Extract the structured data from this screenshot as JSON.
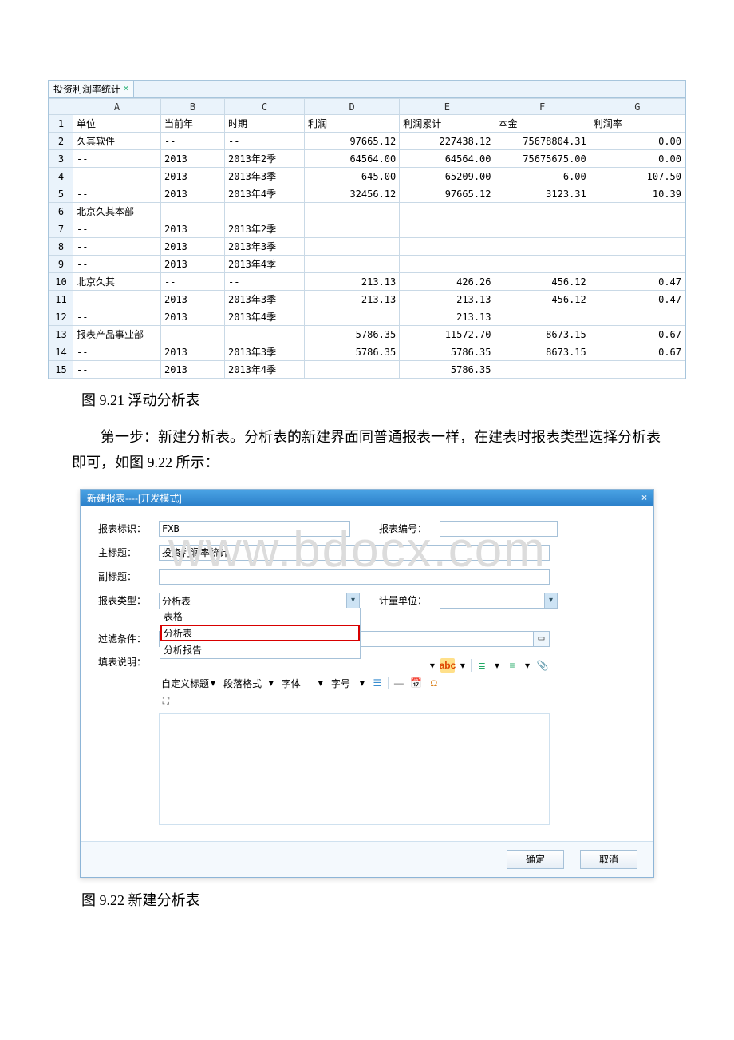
{
  "sheet": {
    "tab_label": "投资利润率统计",
    "columns": [
      "",
      "A",
      "B",
      "C",
      "D",
      "E",
      "F",
      "G"
    ],
    "header_row": [
      "单位",
      "当前年",
      "时期",
      "利润",
      "利润累计",
      "本金",
      "利润率"
    ],
    "rows": [
      {
        "n": "1",
        "A": "单位",
        "B": "当前年",
        "C": "时期",
        "D": "利润",
        "E": "利润累计",
        "F": "本金",
        "G": "利润率",
        "txtRow": true
      },
      {
        "n": "2",
        "A": "久其软件",
        "B": "--",
        "C": "--",
        "D": "97665.12",
        "E": "227438.12",
        "F": "75678804.31",
        "G": "0.00"
      },
      {
        "n": "3",
        "A": "--",
        "B": "2013",
        "C": "2013年2季",
        "D": "64564.00",
        "E": "64564.00",
        "F": "75675675.00",
        "G": "0.00"
      },
      {
        "n": "4",
        "A": "--",
        "B": "2013",
        "C": "2013年3季",
        "D": "645.00",
        "E": "65209.00",
        "F": "6.00",
        "G": "107.50"
      },
      {
        "n": "5",
        "A": "--",
        "B": "2013",
        "C": "2013年4季",
        "D": "32456.12",
        "E": "97665.12",
        "F": "3123.31",
        "G": "10.39"
      },
      {
        "n": "6",
        "A": "北京久其本部",
        "B": "--",
        "C": "--",
        "D": "",
        "E": "",
        "F": "",
        "G": ""
      },
      {
        "n": "7",
        "A": "--",
        "B": "2013",
        "C": "2013年2季",
        "D": "",
        "E": "",
        "F": "",
        "G": ""
      },
      {
        "n": "8",
        "A": "--",
        "B": "2013",
        "C": "2013年3季",
        "D": "",
        "E": "",
        "F": "",
        "G": ""
      },
      {
        "n": "9",
        "A": "--",
        "B": "2013",
        "C": "2013年4季",
        "D": "",
        "E": "",
        "F": "",
        "G": ""
      },
      {
        "n": "10",
        "A": "北京久其",
        "B": "--",
        "C": "--",
        "D": "213.13",
        "E": "426.26",
        "F": "456.12",
        "G": "0.47"
      },
      {
        "n": "11",
        "A": "--",
        "B": "2013",
        "C": "2013年3季",
        "D": "213.13",
        "E": "213.13",
        "F": "456.12",
        "G": "0.47"
      },
      {
        "n": "12",
        "A": "--",
        "B": "2013",
        "C": "2013年4季",
        "D": "",
        "E": "213.13",
        "F": "",
        "G": ""
      },
      {
        "n": "13",
        "A": "报表产品事业部",
        "B": "--",
        "C": "--",
        "D": "5786.35",
        "E": "11572.70",
        "F": "8673.15",
        "G": "0.67"
      },
      {
        "n": "14",
        "A": "--",
        "B": "2013",
        "C": "2013年3季",
        "D": "5786.35",
        "E": "5786.35",
        "F": "8673.15",
        "G": "0.67"
      },
      {
        "n": "15",
        "A": "--",
        "B": "2013",
        "C": "2013年4季",
        "D": "",
        "E": "5786.35",
        "F": "",
        "G": ""
      }
    ]
  },
  "caption1": "图 9.21 浮动分析表",
  "paragraph1": "第一步：新建分析表。分析表的新建界面同普通报表一样，在建表时报表类型选择分析表即可，如图 9.22 所示：",
  "dialog": {
    "title": "新建报表----[开发模式]",
    "labels": {
      "id": "报表标识：",
      "no": "报表编号：",
      "title": "主标题：",
      "subtitle": "副标题：",
      "type": "报表类型：",
      "unit": "计量单位：",
      "filter": "过滤条件：",
      "desc": "填表说明："
    },
    "values": {
      "id": "FXB",
      "title": "投资利润率统计",
      "type_selected": "分析表",
      "type_options": [
        "表格",
        "分析表",
        "分析报告"
      ],
      "unit": ""
    },
    "toolbar": {
      "style_label": "自定义标题",
      "para_label": "段落格式",
      "font_label": "字体",
      "size_label": "字号",
      "abc": "abc"
    },
    "buttons": {
      "ok": "确定",
      "cancel": "取消"
    },
    "watermark": "www.bdocx.com"
  },
  "caption2": "图 9.22 新建分析表"
}
